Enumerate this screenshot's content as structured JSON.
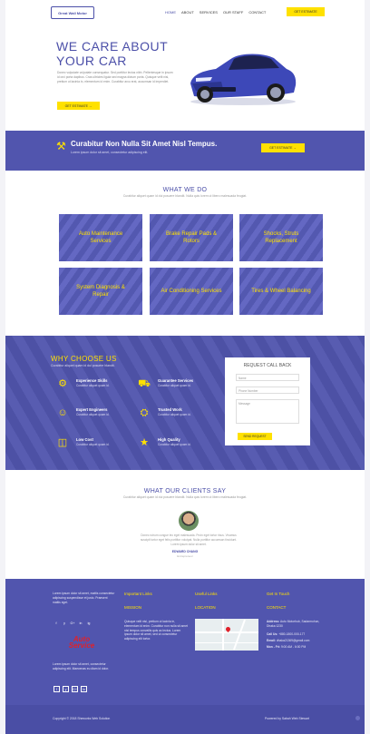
{
  "header": {
    "logo_text": "Great Wall Motor",
    "nav": [
      "HOME",
      "ABOUT",
      "SERVICES",
      "OUR STAFF",
      "CONTACT"
    ],
    "cta": "GET ESTIMATE"
  },
  "hero": {
    "title_line1": "WE CARE ABOUT",
    "title_line2": "YOUR CAR",
    "text": "Donec vulputate vulputate consequatur. Sed porttitor lectus nibh. Pellentesque in ipsum id orci porta dapibus. Cras ultricies ligula sed magna dictum porta. Quisque velit nisi, pretium ut lacinia in, elementum id enim. Curabitur arcu erat, accumsan id imperdiet.",
    "button": "GET ESTIMATE →"
  },
  "banner": {
    "title": "Curabitur Non Nulla Sit Amet Nisl Tempus.",
    "subtitle": "Lorem ipsum dolor sit amet, consectetur adipiscing elit.",
    "button": "GET ESTIMATE →"
  },
  "services": {
    "title": "WHAT WE DO",
    "subtitle": "Curabitur aliquet quam id dui posuere blandit. Nulla quis lorem ut libero malesuada feugiat.",
    "items": [
      "Auto Maintenance Services",
      "Brake Repair Pads & Rotors",
      "Shocks, Struts Replacement",
      "System Diagnosis & Repair",
      "Air Conditioning Services",
      "Tires & Wheel Balancing"
    ]
  },
  "why": {
    "title": "WHY CHOOSE US",
    "subtitle": "Curabitur aliquet quam id dui posuere blandit.",
    "features": [
      {
        "title": "Experience Skills",
        "text": "Curabitur aliquet quam id."
      },
      {
        "title": "Guarantee Services",
        "text": "Curabitur aliquet quam id."
      },
      {
        "title": "Expert Engineers",
        "text": "Curabitur aliquet quam id."
      },
      {
        "title": "Trusted Work",
        "text": "Curabitur aliquet quam id."
      },
      {
        "title": "Low Cost",
        "text": "Curabitur aliquet quam id."
      },
      {
        "title": "High Quality",
        "text": "Curabitur aliquet quam id."
      }
    ],
    "form": {
      "title": "REQUEST CALL BACK",
      "name_placeholder": "Name",
      "phone_placeholder": "Phone Number",
      "message_placeholder": "Message",
      "button": "SEND REQUEST"
    }
  },
  "testimonials": {
    "title": "WHAT OUR CLIENTS SAY",
    "subtitle": "Curabitur aliquet quam id dui posuere blandit. Nulla quis lorem ut libero malesuada feugiat.",
    "quote": "Donec rutrum congue leo eget malesuada. Proin eget tortor risus. Vivamus suscipit tortor eget felis porttitor volutpat. Nulla porttitor accumsan tincidunt. Lorem ipsum dolor sit amet.",
    "name": "EDWARD CHANG",
    "role": "Entrepreneur"
  },
  "footer": {
    "about": "Lorem ipsum dolor sit amet, mattis consectetur adipiscing suspendisse et justo. Praesent mattis eget.",
    "social_icons": [
      "f",
      "y",
      "G+",
      "in",
      "ig"
    ],
    "brand_line1": "Auto",
    "brand_line2": "Service",
    "about2": "Lorem ipsum dolor sit amet, consectetur adipiscing elit. Maecenas eu diam id dolor.",
    "social_icons2": [
      "f",
      "y",
      "G+",
      "in"
    ],
    "col2_heading": "Important Links",
    "col2_sub": "MISSION",
    "col2_text": "Quisque velit nisi, pretium ut lacinia in, elementum id enim. Curabitur non nulla sit amet nisl tempus convallis quis ac lectus. Lorem ipsum dolor sit amet, sed ut consectetur adipiscing elit tortor.",
    "col3_heading": "Useful Links",
    "col3_sub": "LOCATION",
    "col4_heading": "Get In Touch",
    "col4_sub": "CONTACT",
    "address_label": "Address:",
    "address": "Auto Motorhub, Sadarmohon, Dhaka 1230",
    "call_label": "Call Us:",
    "call": "+880-1800-000-177",
    "email_label": "Email:",
    "email": "dhaka21369@gmail.com",
    "hours_label": "Mon - Fri:",
    "hours": "9:00 AM - 6:00 PM",
    "copyright": "Copyright © 2018 Sheworks Web Solution",
    "powered": "Powered by Sabah Web Stewart"
  },
  "colors": {
    "primary": "#5155ae",
    "accent": "#ffe100",
    "heading": "#4b4fa8"
  }
}
